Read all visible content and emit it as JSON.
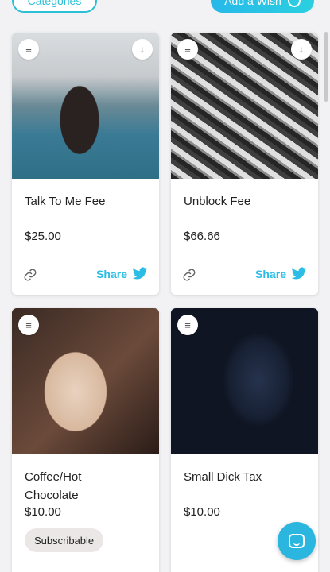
{
  "header": {
    "categories_label": "Categories",
    "add_wish_label": "Add a Wish"
  },
  "cards": [
    {
      "title": "Talk To Me Fee",
      "price": "$25.00",
      "share_label": "Share"
    },
    {
      "title": "Unblock Fee",
      "price": "$66.66",
      "share_label": "Share"
    },
    {
      "title": "Coffee/Hot Chocolate",
      "price": "$10.00",
      "badge": "Subscribable"
    },
    {
      "title": "Small Dick Tax",
      "price": "$10.00"
    }
  ],
  "icons": {
    "menu": "menu-icon",
    "download": "download-icon",
    "link": "link-icon",
    "twitter": "twitter-icon",
    "chat": "chat-icon"
  },
  "colors": {
    "accent": "#2bbde6",
    "background": "#f2f2f5"
  }
}
